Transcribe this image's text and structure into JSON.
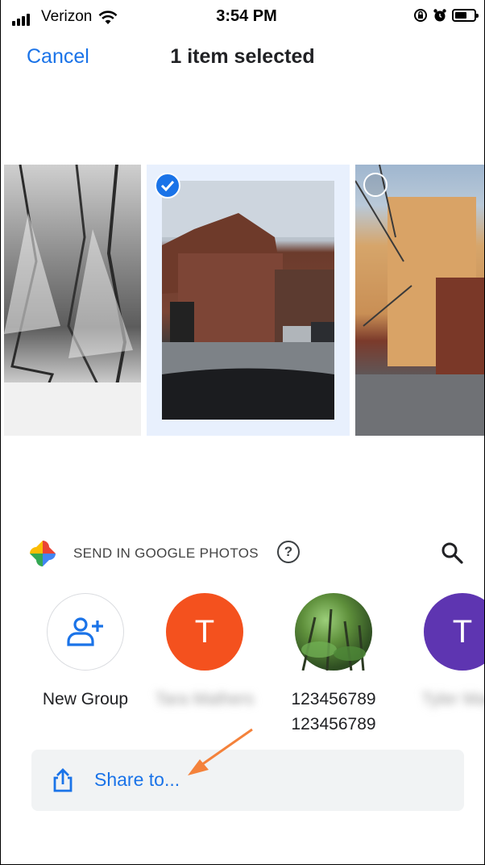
{
  "status_bar": {
    "carrier": "Verizon",
    "time": "3:54 PM"
  },
  "header": {
    "cancel_label": "Cancel",
    "title": "1 item selected"
  },
  "photos": [
    {
      "selected": false
    },
    {
      "selected": true
    },
    {
      "selected": false
    }
  ],
  "send_section": {
    "label": "SEND IN GOOGLE PHOTOS",
    "help_label": "?"
  },
  "contacts": [
    {
      "initial": "",
      "name": "New Group"
    },
    {
      "initial": "T",
      "name": "Tara Mathers"
    },
    {
      "initial": "",
      "name_line1": "123456789",
      "name_line2": "123456789"
    },
    {
      "initial": "T",
      "name": "Tyler Mack"
    }
  ],
  "share": {
    "label": "Share to..."
  },
  "colors": {
    "accent": "#1a73e8",
    "orange_avatar": "#f4511e",
    "purple_avatar": "#5e35b1",
    "annotation_arrow": "#f4823b"
  }
}
